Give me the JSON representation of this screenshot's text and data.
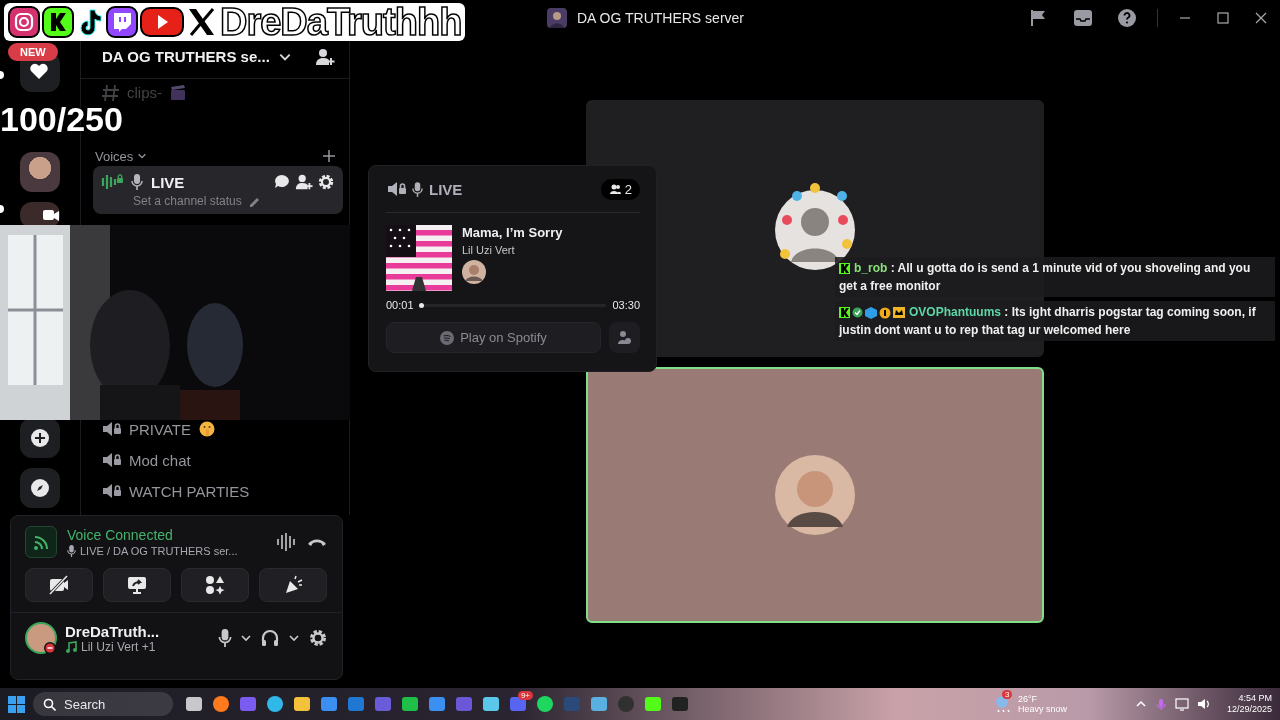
{
  "stream_overlay": {
    "handle": "DreDaTruthhh",
    "counter": "100/250",
    "chat": [
      {
        "user": "b_rob",
        "color": "#8be07a",
        "text": ": All u gotta do is send a 1 minute vid of you shoveling and you get a free monitor"
      },
      {
        "user": "OVOPhantuums",
        "color": "#5fd6a8",
        "text": ": Its ight dharris pogstar tag coming soon, if justin dont want u to rep that tag ur welcomed here"
      }
    ]
  },
  "window": {
    "title": "DA OG TRUTHERS server"
  },
  "servers": {
    "new_badge": "NEW"
  },
  "sidebar": {
    "server_name": "DA OG TRUTHERS se...",
    "channels": [
      {
        "kind": "text",
        "name": "clips-",
        "selected": false
      },
      {
        "kind": "category",
        "name": "Voices"
      },
      {
        "kind": "voice",
        "name": "LIVE",
        "status": "Set a channel status",
        "selected": true
      },
      {
        "kind": "voice",
        "name": "PRIVATE",
        "selected": false
      },
      {
        "kind": "voice",
        "name": "Mod chat",
        "selected": false
      },
      {
        "kind": "voice",
        "name": "WATCH PARTIES",
        "selected": false
      }
    ]
  },
  "voice_popup": {
    "channel": "LIVE",
    "member_count": "2",
    "track": "Mama, I’m Sorry",
    "artist": "Lil Uzi Vert",
    "elapsed": "00:01",
    "duration": "03:30",
    "level": 0.01,
    "action": "Play on Spotify"
  },
  "voice_panel": {
    "status": "Voice Connected",
    "location": "LIVE / DA OG TRUTHERS ser..."
  },
  "user": {
    "name": "DreDaTruth...",
    "activity": "Lil Uzi Vert +1"
  },
  "stage": {
    "tiles": [
      {
        "speaking": false
      },
      {
        "speaking": true
      }
    ]
  },
  "taskbar": {
    "search": "Search",
    "weather_badge": "3",
    "temperature": "26°F",
    "weather": "Heavy snow",
    "discord_badge": "9+",
    "time": "4:54 PM",
    "date": "12/29/2025"
  }
}
